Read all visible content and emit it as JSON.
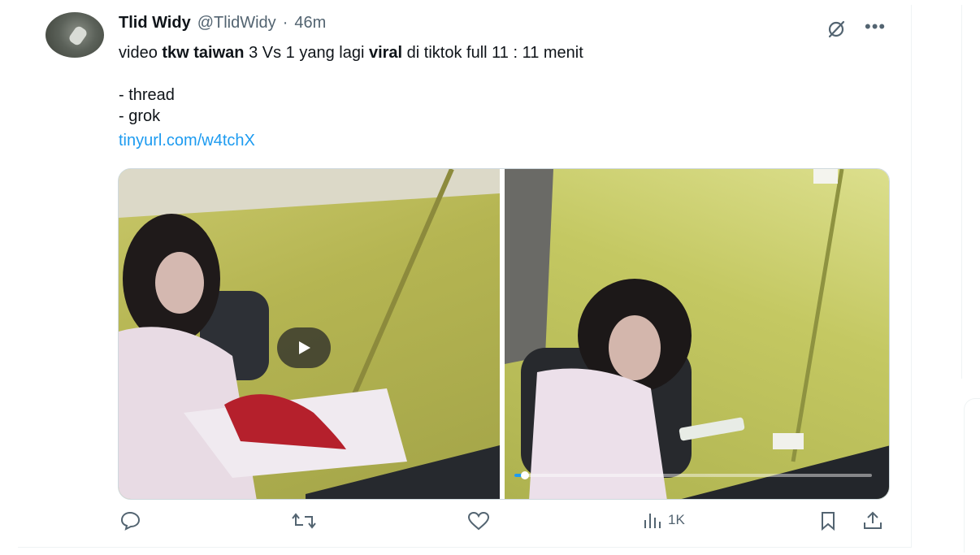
{
  "tweet": {
    "author_name": "Tlid Widy",
    "author_handle": "@TlidWidy",
    "separator": "·",
    "time": "46m",
    "text": {
      "line1": {
        "p1": "video ",
        "b1": "tkw taiwan",
        "p2": " 3 Vs 1 yang lagi ",
        "b2": "viral",
        "p3": " di tiktok full 11 : 11 menit"
      },
      "line2": "- thread",
      "line3": "- grok",
      "link": "tinyurl.com/w4tchX"
    },
    "media": {
      "images": [
        "left-image",
        "right-image"
      ],
      "video_progress": 0.03
    },
    "actions": {
      "views": "1K"
    },
    "icons": {
      "grok": "grok-icon",
      "more": "more-icon",
      "reply": "reply-icon",
      "retweet": "retweet-icon",
      "like": "heart-icon",
      "views": "views-icon",
      "bookmark": "bookmark-icon",
      "share": "share-icon"
    },
    "colors": {
      "link": "#1d9bf0",
      "muted": "#536471"
    }
  }
}
